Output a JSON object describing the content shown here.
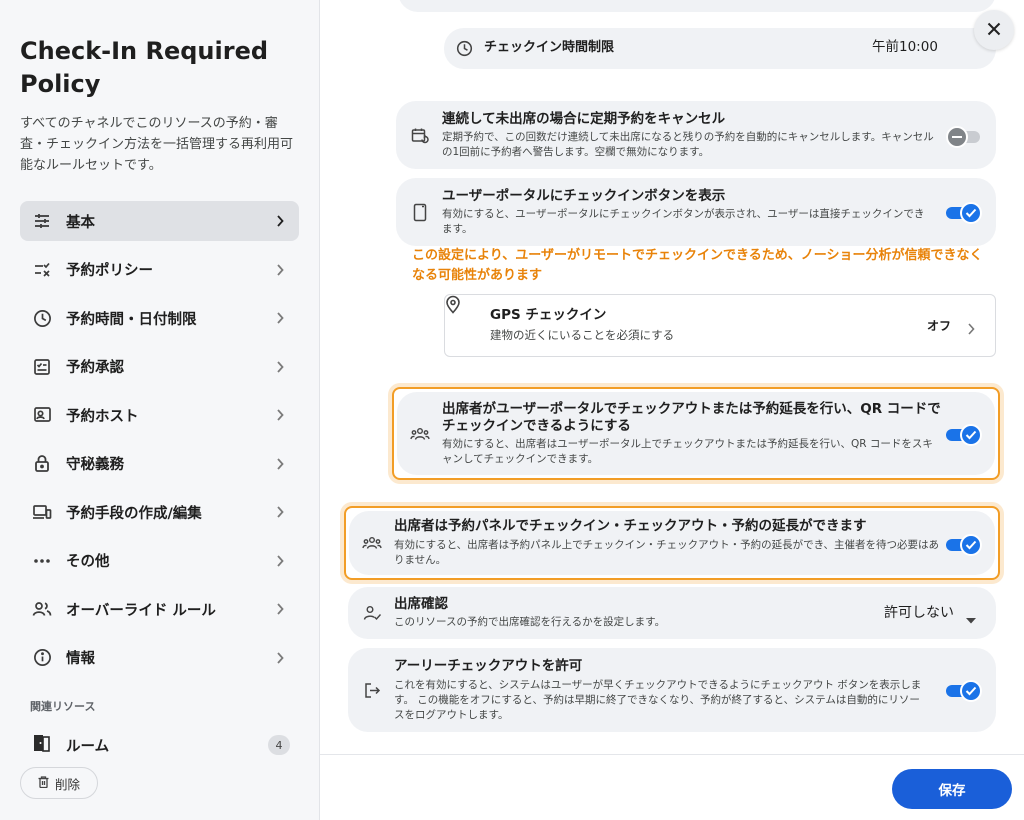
{
  "sidebar": {
    "title": "Check-In Required Policy",
    "description": "すべてのチャネルでこのリソースの予約・審査・チェックイン方法を一括管理する再利用可能なルールセットです。",
    "nav": [
      {
        "label": "基本",
        "icon": "sliders-icon",
        "active": true
      },
      {
        "label": "予約ポリシー",
        "icon": "checklist-icon"
      },
      {
        "label": "予約時間・日付制限",
        "icon": "clock-icon"
      },
      {
        "label": "予約承認",
        "icon": "approval-icon"
      },
      {
        "label": "予約ホスト",
        "icon": "host-icon"
      },
      {
        "label": "守秘義務",
        "icon": "lock-icon"
      },
      {
        "label": "予約手段の作成/編集",
        "icon": "devices-icon"
      },
      {
        "label": "その他",
        "icon": "more-icon"
      },
      {
        "label": "オーバーライド ルール",
        "icon": "users-icon"
      },
      {
        "label": "情報",
        "icon": "info-icon"
      }
    ],
    "related_title": "関連リソース",
    "room_label": "ルーム",
    "room_count": "4",
    "delete_label": "削除"
  },
  "main": {
    "checkin_time_limit": {
      "label": "チェックイン時間制限",
      "value": "午前10:00"
    },
    "cancel_recurring": {
      "title": "連続して未出席の場合に定期予約をキャンセル",
      "desc": "定期予約で、この回数だけ連続して未出席になると残りの予約を自動的にキャンセルします。キャンセルの1回前に予約者へ警告します。空欄で無効になります。",
      "enabled": false
    },
    "portal_checkin": {
      "title": "ユーザーポータルにチェックインボタンを表示",
      "desc": "有効にすると、ユーザーポータルにチェックインボタンが表示され、ユーザーは直接チェックインできます。",
      "enabled": true
    },
    "warning": "この設定により、ユーザーがリモートでチェックインできるため、ノーショー分析が信頼できなくなる可能性があります",
    "gps": {
      "title": "GPS チェックイン",
      "desc": "建物の近くにいることを必須にする",
      "value": "オフ"
    },
    "attendee_portal": {
      "title": "出席者がユーザーポータルでチェックアウトまたは予約延長を行い、QR コードでチェックインできるようにする",
      "desc": "有効にすると、出席者はユーザーポータル上でチェックアウトまたは予約延長を行い、QR コードをスキャンしてチェックインできます。",
      "enabled": true
    },
    "attendee_panel": {
      "title": "出席者は予約パネルでチェックイン・チェックアウト・予約の延長ができます",
      "desc": "有効にすると、出席者は予約パネル上でチェックイン・チェックアウト・予約の延長ができ、主催者を待つ必要はありません。",
      "enabled": true
    },
    "attendance_confirm": {
      "title": "出席確認",
      "desc": "このリソースの予約で出席確認を行えるかを設定します。",
      "value": "許可しない"
    },
    "early_checkout": {
      "title": "アーリーチェックアウトを許可",
      "desc": "これを有効にすると、システムはユーザーが早くチェックアウトできるようにチェックアウト ボタンを表示します。 この機能をオフにすると、予約は早期に終了できなくなり、予約が終了すると、システムは自動的にリソースをログアウトします。",
      "enabled": true
    },
    "save_label": "保存"
  },
  "colors": {
    "accent": "#1a73e8",
    "warning": "#e8830a",
    "highlight": "#f29d26"
  }
}
